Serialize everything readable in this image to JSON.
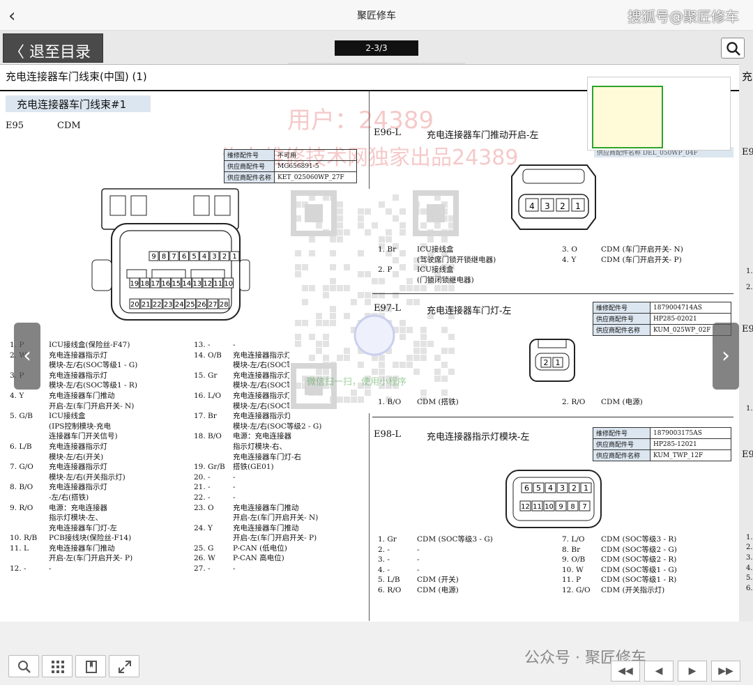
{
  "app": {
    "back_glyph": "‹",
    "title": "聚匠修车",
    "watermark": "搜狐号@聚匠修车"
  },
  "viewer": {
    "back_to_toc": "〈 退至目录",
    "page_indicator": "2-3/3",
    "prev_label": "‹",
    "next_label": "›"
  },
  "page": {
    "header": "充电连接器车门线束(中国) (1)",
    "right_page_tag": "充",
    "section_title": "充电连接器车门线束#1",
    "watermarks": [
      "用户：24389",
      "汽车维修技术网独家出品24389"
    ],
    "qr_caption": "微信扫一扫，使用小程序"
  },
  "e95": {
    "code": "E95",
    "name": "CDM",
    "info": [
      {
        "k": "维修配件号",
        "v": "不可用"
      },
      {
        "k": "供应商配件号",
        "v": "MG656891-5"
      },
      {
        "k": "供应商配件名称",
        "v": "KET_025060WP_27F"
      }
    ],
    "connector_row1": [
      "9",
      "8",
      "7",
      "6",
      "5",
      "4",
      "3",
      "2",
      "1"
    ],
    "connector_row2": [
      "19",
      "18",
      "17",
      "16",
      "15",
      "14",
      "13",
      "12",
      "11",
      "10"
    ],
    "connector_row3": [
      "20",
      "21",
      "22",
      "23",
      "24",
      "25",
      "26",
      "27",
      "28"
    ],
    "pins_left": [
      {
        "n": "1. P",
        "d": [
          "ICU接线盒(保险丝-F47)"
        ]
      },
      {
        "n": "2. W",
        "d": [
          "充电连接器指示灯",
          "模块-左/右(SOC等级1 - G)"
        ]
      },
      {
        "n": "3. P",
        "d": [
          "充电连接器指示灯",
          "模块-左/右(SOC等级1 - R)"
        ]
      },
      {
        "n": "4. Y",
        "d": [
          "充电连接器车门推动",
          "开启-左(车门开启开关- N)"
        ]
      },
      {
        "n": "5. G/B",
        "d": [
          "ICU接线盒",
          "(IPS控制模块-充电",
          "连接器车门开关信号)"
        ]
      },
      {
        "n": "6. L/B",
        "d": [
          "充电连接器指示灯",
          "模块-左/右(开关)"
        ]
      },
      {
        "n": "7. G/O",
        "d": [
          "充电连接器指示灯",
          "模块-左/右(开关指示灯)"
        ]
      },
      {
        "n": "8. B/O",
        "d": [
          "充电连接器指示灯",
          "-左/右(搭铁)"
        ]
      },
      {
        "n": "9. R/O",
        "d": [
          "电源：充电连接器",
          "指示灯模块-左、",
          "充电连接器车门灯-左"
        ]
      },
      {
        "n": "10. R/B",
        "d": [
          "PCB接线块(保险丝-F14)"
        ]
      },
      {
        "n": "11. L",
        "d": [
          "充电连接器车门推动",
          "开启-左(车门开启开关- P)"
        ]
      },
      {
        "n": "12. -",
        "d": [
          "-"
        ]
      }
    ],
    "pins_right": [
      {
        "n": "13. -",
        "d": [
          "-"
        ]
      },
      {
        "n": "14. O/B",
        "d": [
          "充电连接器指示灯",
          "模块-左/右(SOC等级2 - R)"
        ]
      },
      {
        "n": "15. Gr",
        "d": [
          "充电连接器指示灯",
          "模块-左/右(SOC等级3 - G)"
        ]
      },
      {
        "n": "16. L/O",
        "d": [
          "充电连接器指示灯",
          "模块-左/右(SOC等级3 - R)"
        ]
      },
      {
        "n": "17. Br",
        "d": [
          "充电连接器指示灯",
          "模块-左/右(SOC等级2 - G)"
        ]
      },
      {
        "n": "18. B/O",
        "d": [
          "电源：充电连接器",
          "指示灯模块-右、",
          "充电连接器车门灯-右"
        ]
      },
      {
        "n": "19. Gr/B",
        "d": [
          "搭铁(GE01)"
        ]
      },
      {
        "n": "20. -",
        "d": [
          "-"
        ]
      },
      {
        "n": "21. -",
        "d": [
          "-"
        ]
      },
      {
        "n": "22. -",
        "d": [
          "-"
        ]
      },
      {
        "n": "23. O",
        "d": [
          "充电连接器车门推动",
          "开启-左(车门开启开关- N)"
        ]
      },
      {
        "n": "24. Y",
        "d": [
          "充电连接器车门推动",
          "开启-左(车门开启开关- P)"
        ]
      },
      {
        "n": "25. G",
        "d": [
          "P-CAN (低电位)"
        ]
      },
      {
        "n": "26. W",
        "d": [
          "P-CAN 高电位)"
        ]
      },
      {
        "n": "27. -",
        "d": [
          "-"
        ]
      }
    ]
  },
  "e96": {
    "code": "E96-L",
    "name": "充电连接器车门推动开启-左",
    "info_partial": "供应商配件名称  DEL_050WP_04F",
    "connector": [
      "4",
      "3",
      "2",
      "1"
    ],
    "pins_left": [
      {
        "n": "1. Br",
        "d": [
          "ICU接线盒",
          "(驾驶席门锁开锁继电器)"
        ]
      },
      {
        "n": "2. P",
        "d": [
          "ICU接线盒",
          "(门锁闭锁继电器)"
        ]
      }
    ],
    "pins_right": [
      {
        "n": "3. O",
        "d": [
          "CDM (车门开启开关- N)"
        ]
      },
      {
        "n": "4. Y",
        "d": [
          "CDM (车门开启开关- P)"
        ]
      }
    ]
  },
  "e97": {
    "code": "E97-L",
    "name": "充电连接器车门灯-左",
    "info": [
      {
        "k": "维修配件号",
        "v": "1879004714AS"
      },
      {
        "k": "供应商配件号",
        "v": "HP285-02021"
      },
      {
        "k": "供应商配件名称",
        "v": "KUM_025WP_02F"
      }
    ],
    "connector": [
      "2",
      "1"
    ],
    "pins_left": [
      {
        "n": "1. B/O",
        "d": [
          "CDM (搭铁)"
        ]
      }
    ],
    "pins_right": [
      {
        "n": "2. R/O",
        "d": [
          "CDM (电源)"
        ]
      }
    ]
  },
  "e98": {
    "code": "E98-L",
    "name": "充电连接器指示灯模块-左",
    "info": [
      {
        "k": "维修配件号",
        "v": "1879003175AS"
      },
      {
        "k": "供应商配件号",
        "v": "HP285-12021"
      },
      {
        "k": "供应商配件名称",
        "v": "KUM_TWP_12F"
      }
    ],
    "connector_row1": [
      "6",
      "5",
      "4",
      "3",
      "2",
      "1"
    ],
    "connector_row2": [
      "12",
      "11",
      "10",
      "9",
      "8",
      "7"
    ],
    "pins_left": [
      {
        "n": "1. Gr",
        "d": [
          "CDM (SOC等级3 - G)"
        ]
      },
      {
        "n": "2. -",
        "d": [
          "-"
        ]
      },
      {
        "n": "3. -",
        "d": [
          "-"
        ]
      },
      {
        "n": "4. -",
        "d": [
          "-"
        ]
      },
      {
        "n": "5. L/B",
        "d": [
          "CDM (开关)"
        ]
      },
      {
        "n": "6. R/O",
        "d": [
          "CDM (电源)"
        ]
      }
    ],
    "pins_right": [
      {
        "n": "7. L/O",
        "d": [
          "CDM (SOC等级3 - R)"
        ]
      },
      {
        "n": "8. Br",
        "d": [
          "CDM (SOC等级2 - G)"
        ]
      },
      {
        "n": "9. O/B",
        "d": [
          "CDM (SOC等级2 - R)"
        ]
      },
      {
        "n": "10. W",
        "d": [
          "CDM (SOC等级1 - G)"
        ]
      },
      {
        "n": "11. P",
        "d": [
          "CDM (SOC等级1 - R)"
        ]
      },
      {
        "n": "12. G/O",
        "d": [
          "CDM (开关指示灯)"
        ]
      }
    ]
  },
  "right_edge": {
    "codes": [
      "E9",
      "E9",
      "E9"
    ],
    "numbers": [
      "1.",
      "2.",
      "1.",
      "1.",
      "2.",
      "3.",
      "4.",
      "5.",
      "6."
    ]
  },
  "bottom": {
    "official_account": "公众号 · 聚匠修车",
    "tools": [
      "zoom-icon",
      "grid-icon",
      "bookmark-icon",
      "fullscreen-icon"
    ],
    "nav": [
      "◀◀",
      "◀",
      "▶",
      "▶▶"
    ]
  },
  "colors": {
    "section_bg": "#dce6f0",
    "back_button_bg": "#4a4a4a",
    "thumb_highlight": "#2ba32b",
    "watermark_red": "#dc3c3c"
  }
}
